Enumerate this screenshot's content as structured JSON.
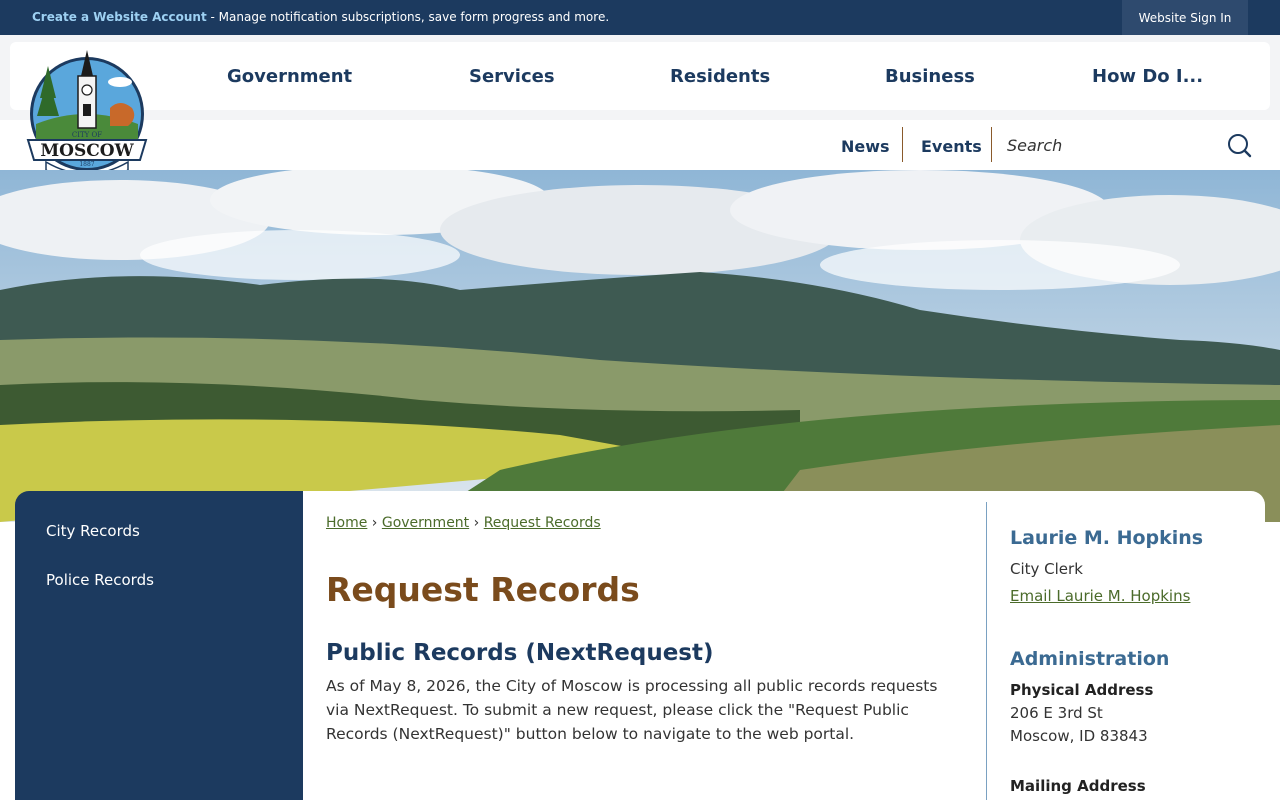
{
  "topbar": {
    "create_account_link": "Create a Website Account",
    "message": " - Manage notification subscriptions, save form progress and more.",
    "sign_in": "Website Sign In"
  },
  "nav": {
    "items": [
      "Government",
      "Services",
      "Residents",
      "Business",
      "How Do I..."
    ]
  },
  "secondary_nav": {
    "news": "News",
    "events": "Events",
    "search_placeholder": "Search"
  },
  "sidebar": {
    "items": [
      "City Records",
      "Police Records"
    ]
  },
  "breadcrumb": {
    "home": "Home",
    "government": "Government",
    "current": "Request Records",
    "separator": "›"
  },
  "main": {
    "title": "Request Records",
    "subtitle": "Public Records (NextRequest)",
    "body": "As of May 8, 2026, the City of Moscow is processing all public records requests via NextRequest. To submit a new request, please click the \"Request Public Records (NextRequest)\" button below to navigate to the web portal."
  },
  "contact": {
    "name": "Laurie M. Hopkins",
    "role": "City Clerk",
    "email_link": "Email Laurie M. Hopkins"
  },
  "admin": {
    "title": "Administration",
    "physical_label": "Physical Address",
    "street": "206 E 3rd St",
    "city_state": "Moscow, ID 83843",
    "mailing_label": "Mailing Address"
  },
  "logo": {
    "city_of": "CITY OF",
    "name": "MOSCOW",
    "year": "1887",
    "state": "IDAHO"
  },
  "colors": {
    "navy": "#1c3a5f",
    "brown": "#7a4b1c",
    "green_link": "#4b6b2a",
    "blue_heading": "#3b6a92"
  }
}
